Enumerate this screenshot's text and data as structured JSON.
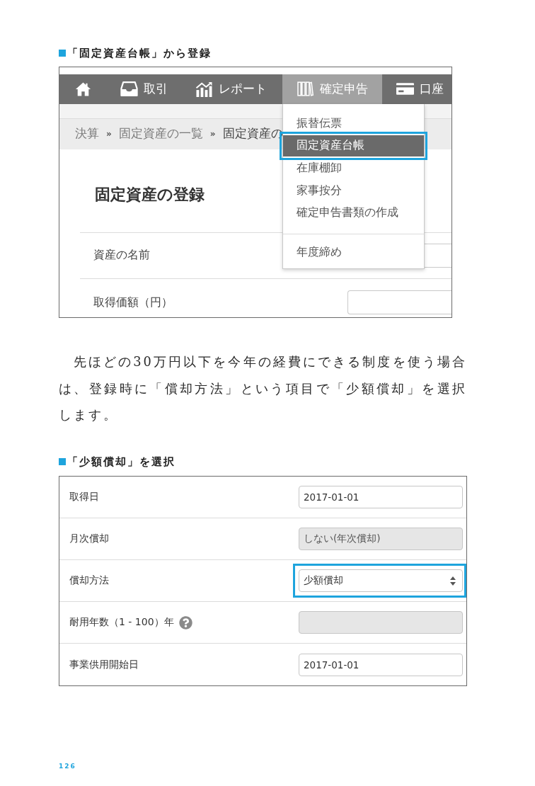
{
  "figure_1": {
    "caption": "「固定資産台帳」から登録",
    "nav": {
      "items": [
        {
          "selected": false
        },
        {
          "label": "取引",
          "selected": false
        },
        {
          "label": "レポート",
          "selected": false
        },
        {
          "label": "確定申告",
          "selected": true
        },
        {
          "label": "口座",
          "selected": false
        }
      ]
    },
    "breadcrumb": [
      {
        "kind": "link",
        "text": "決算"
      },
      {
        "kind": "separator",
        "text": "»"
      },
      {
        "kind": "link",
        "text": "固定資産の一覧"
      },
      {
        "kind": "separator",
        "text": "»"
      },
      {
        "kind": "current",
        "text": "固定資産の"
      }
    ],
    "heading": "固定資産の登録",
    "form_rows": [
      {
        "label": "資産の名前",
        "field": {
          "kind": "input",
          "disabled": false
        }
      },
      {
        "label": "取得価額（円）",
        "field": {
          "kind": "input",
          "disabled": false
        }
      }
    ],
    "dropdown": {
      "groups": [
        [
          {
            "label": "振替伝票",
            "selected": false,
            "highlighted": false
          },
          {
            "label": "固定資産台帳",
            "selected": true,
            "highlighted": true
          },
          {
            "label": "在庫棚卸",
            "selected": false,
            "highlighted": false
          },
          {
            "label": "家事按分",
            "selected": false,
            "highlighted": false
          },
          {
            "label": "確定申告書類の作成",
            "selected": false,
            "highlighted": false
          }
        ],
        [
          {
            "label": "年度締め",
            "selected": false,
            "highlighted": false
          }
        ]
      ]
    }
  },
  "paragraph": "先ほどの30万円以下を今年の経費にできる制度を使う場合は、登録時に「償却方法」という項目で「少額償却」を選択します。",
  "figure_2": {
    "caption": "「少額償却」を選択",
    "form_rows": [
      {
        "label": "取得日",
        "help": false,
        "highlighted": false,
        "field": {
          "kind": "input",
          "value": "2017-01-01",
          "disabled": false
        }
      },
      {
        "label": "月次償却",
        "help": false,
        "highlighted": false,
        "field": {
          "kind": "input",
          "value": "しない(年次償却)",
          "disabled": true
        }
      },
      {
        "label": "償却方法",
        "help": false,
        "highlighted": true,
        "field": {
          "kind": "select",
          "value": "少額償却",
          "disabled": false
        }
      },
      {
        "label": "耐用年数（1 - 100）年",
        "help": true,
        "highlighted": false,
        "field": {
          "kind": "input",
          "disabled": true
        }
      },
      {
        "label": "事業供用開始日",
        "help": false,
        "highlighted": false,
        "field": {
          "kind": "input",
          "value": "2017-01-01",
          "disabled": false
        }
      }
    ]
  },
  "page_number": "126"
}
